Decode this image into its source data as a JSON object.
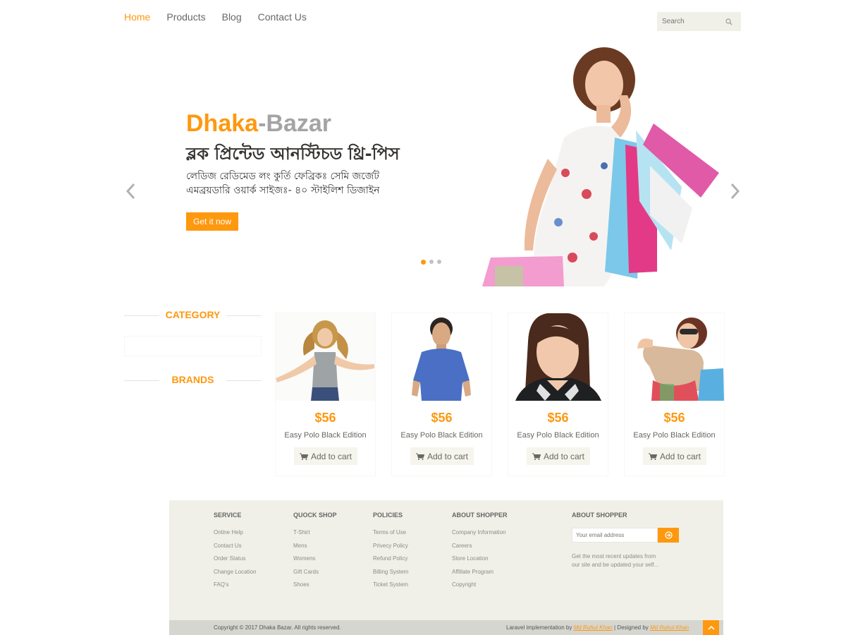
{
  "nav": {
    "items": [
      "Home",
      "Products",
      "Blog",
      "Contact Us"
    ]
  },
  "search": {
    "placeholder": "Search"
  },
  "hero": {
    "brand_a": "Dhaka",
    "brand_sep": "-",
    "brand_b": "Bazar",
    "headline": "ব্লক প্রিন্টেড আনস্টিচড থ্রি-পিস",
    "description": "লেডিজ রেডিমেড লং কুর্তি ফেব্রিকঃ সেমি জর্জেট এমব্রয়ডারি ওয়ার্ক সাইজঃ- ৪০ স্টাইলিশ ডিজাইন",
    "cta": "Get it now"
  },
  "sidebar": {
    "category": "CATEGORY",
    "brands": "BRANDS"
  },
  "products": [
    {
      "price": "$56",
      "name": "Easy Polo Black Edition",
      "cart": "Add to cart"
    },
    {
      "price": "$56",
      "name": "Easy Polo Black Edition",
      "cart": "Add to cart"
    },
    {
      "price": "$56",
      "name": "Easy Polo Black Edition",
      "cart": "Add to cart"
    },
    {
      "price": "$56",
      "name": "Easy Polo Black Edition",
      "cart": "Add to cart"
    }
  ],
  "footer": {
    "cols": [
      {
        "title": "SERVICE",
        "items": [
          "Online Help",
          "Contact Us",
          "Order Status",
          "Change Location",
          "FAQ's"
        ]
      },
      {
        "title": "QUOCK SHOP",
        "items": [
          "T-Shirt",
          "Mens",
          "Womens",
          "Gift Cards",
          "Shoes"
        ]
      },
      {
        "title": "POLICIES",
        "items": [
          "Terms of Use",
          "Privecy Policy",
          "Refund Policy",
          "Billing System",
          "Ticket System"
        ]
      },
      {
        "title": "ABOUT SHOPPER",
        "items": [
          "Company Information",
          "Careers",
          "Store Location",
          "Affillate Program",
          "Copyright"
        ]
      }
    ],
    "subscribe_title": "ABOUT SHOPPER",
    "email_placeholder": "Your email address",
    "subscribe_note": "Get the most recent updates from our site and be updated your self...",
    "copyright": "Copyright © 2017 Dhaka Bazar. All rights reserved.",
    "credit_prefix": "Laravel implementation by ",
    "credit_author1": "Md Ruhul Khan",
    "credit_mid": " | Designed by ",
    "credit_author2": "Md Ruhul Khan"
  },
  "colors": {
    "accent": "#fe980f",
    "footer_bg": "#f0f0e9"
  }
}
